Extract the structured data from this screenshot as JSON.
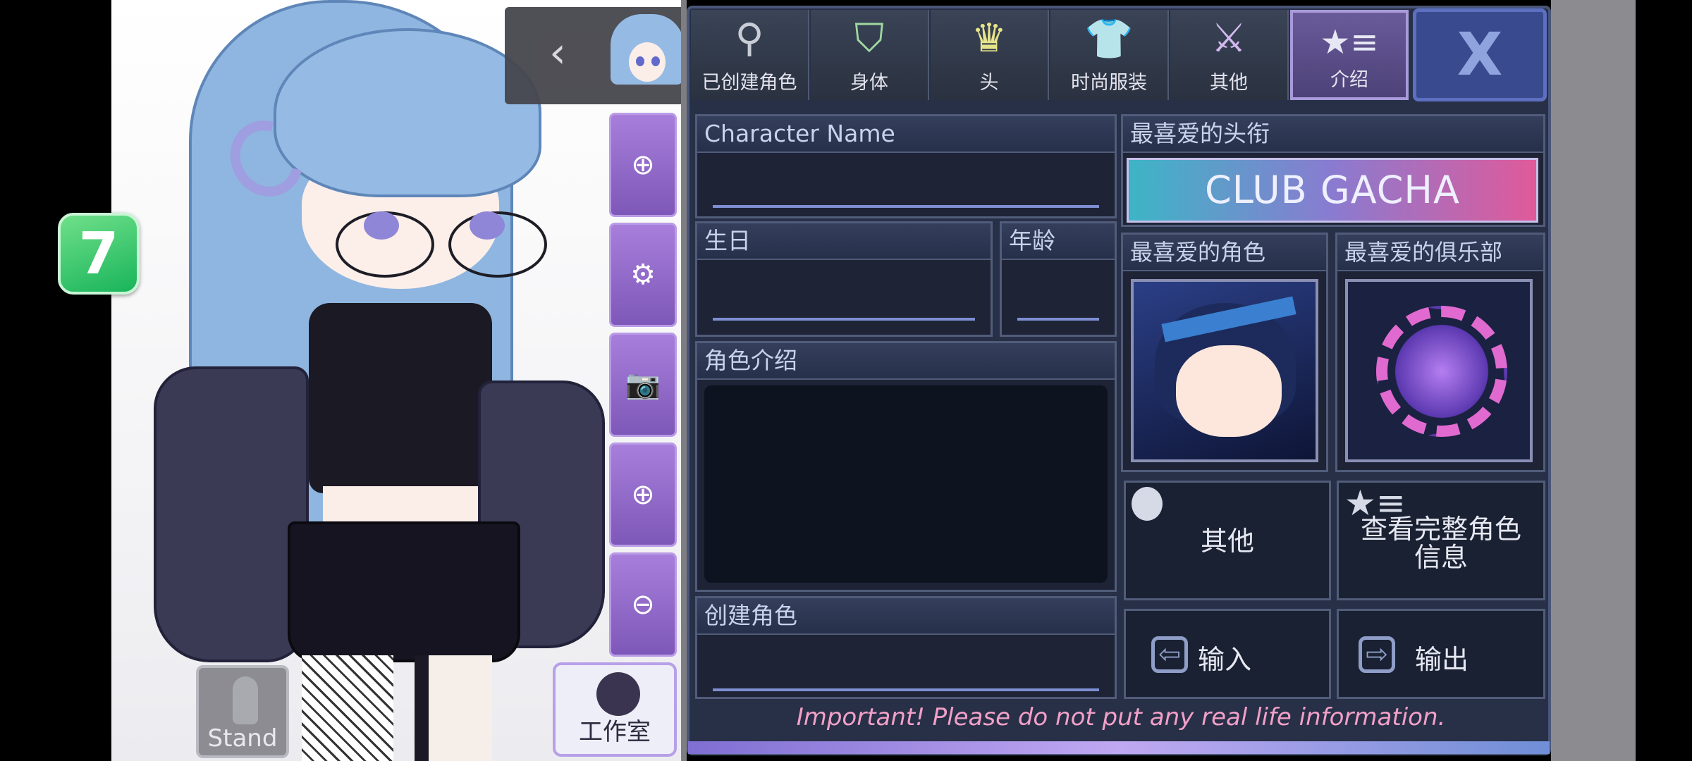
{
  "badge": {
    "label": "7"
  },
  "char_selector": {
    "prev_icon": "chevron-left-icon",
    "next_icon": "chevron-right-icon",
    "prev_glyph": "‹",
    "next_glyph": "›"
  },
  "tools": [
    {
      "name": "add-icon",
      "glyph": "⊕"
    },
    {
      "name": "settings-icon",
      "glyph": "⚙"
    },
    {
      "name": "camera-icon",
      "glyph": "📷"
    },
    {
      "name": "zoom-in-icon",
      "glyph": "⊕"
    },
    {
      "name": "zoom-out-icon",
      "glyph": "⊖"
    }
  ],
  "stand": {
    "label": "Stand"
  },
  "studio": {
    "label": "工作室"
  },
  "tabs": [
    {
      "id": "created",
      "label": "已创建角色",
      "icon": "person-icon",
      "glyph": "⚲"
    },
    {
      "id": "body",
      "label": "身体",
      "icon": "jacket-icon",
      "glyph": "⛉"
    },
    {
      "id": "head",
      "label": "头",
      "icon": "hair-icon",
      "glyph": "♛"
    },
    {
      "id": "fashion",
      "label": "时尚服装",
      "icon": "shirt-icon",
      "glyph": "👕"
    },
    {
      "id": "other",
      "label": "其他",
      "icon": "sword-cat-icon",
      "glyph": "⚔"
    },
    {
      "id": "intro",
      "label": "介绍",
      "icon": "star-list-icon",
      "glyph": "★≡",
      "active": true
    }
  ],
  "close": {
    "label": "X"
  },
  "fields": {
    "name_label": "Character Name",
    "name_value": "",
    "birthday_label": "生日",
    "birthday_value": "",
    "age_label": "年龄",
    "age_value": "",
    "intro_label": "角色介绍",
    "intro_value": "",
    "creator_label": "创建角色",
    "creator_value": ""
  },
  "favorites": {
    "title_label": "最喜爱的头衔",
    "title_value": "CLUB GACHA",
    "character_label": "最喜爱的角色",
    "club_label": "最喜爱的俱乐部"
  },
  "actions": {
    "other": {
      "label": "其他",
      "icon": "apple-icon"
    },
    "full_info": {
      "label": "查看完整角色\n信息",
      "icon": "star-list-icon"
    },
    "import": {
      "label": "输入",
      "icon": "import-icon"
    },
    "export": {
      "label": "输出",
      "icon": "export-icon"
    }
  },
  "warning": "Important! Please do not put any real life information."
}
